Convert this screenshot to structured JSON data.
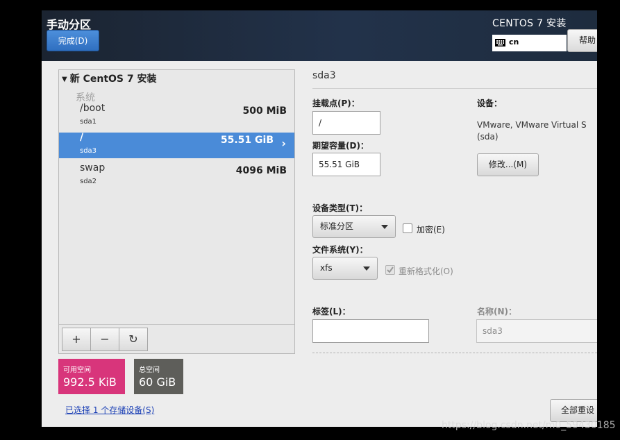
{
  "header": {
    "page_title": "手动分区",
    "done_label": "完成(D)",
    "product_title": "CENTOS 7 安装",
    "keyboard_layout": "cn",
    "help_label": "帮助"
  },
  "partition_panel": {
    "install_title": "新 CentOS 7 安装",
    "group_label": "系统",
    "partitions": [
      {
        "mount": "/boot",
        "device": "sda1",
        "size": "500 MiB",
        "selected": false
      },
      {
        "mount": "/",
        "device": "sda3",
        "size": "55.51 GiB",
        "selected": true
      },
      {
        "mount": "swap",
        "device": "sda2",
        "size": "4096 MiB",
        "selected": false
      }
    ],
    "toolbar": {
      "add_glyph": "+",
      "remove_glyph": "−",
      "refresh_glyph": "↻"
    }
  },
  "space": {
    "available_label": "可用空间",
    "available_value": "992.5 KiB",
    "total_label": "总空间",
    "total_value": "60 GiB",
    "available_color": "#d8357b",
    "total_color": "#5e5e5a"
  },
  "selected_devices_link": "已选择 1 个存储设备(S)",
  "details": {
    "title": "sda3",
    "mount_point_label": "挂载点(P)：",
    "mount_point_value": "/",
    "desired_capacity_label": "期望容量(D)：",
    "desired_capacity_value": "55.51 GiB",
    "device_label": "设备：",
    "device_desc": "VMware, VMware Virtual S (sda)",
    "modify_label": "修改...(M)",
    "device_type_label": "设备类型(T)：",
    "device_type_value": "标准分区",
    "encrypt_label": "加密(E)",
    "filesystem_label": "文件系统(Y)：",
    "filesystem_value": "xfs",
    "reformat_label": "重新格式化(O)",
    "tag_label": "标签(L)：",
    "tag_value": "",
    "name_label": "名称(N)：",
    "name_value": "sda3",
    "reset_all_label": "全部重设"
  },
  "watermark": "https://blog.csdn.net/m0_59430185",
  "colors": {
    "accent": "#4a8bd8",
    "done_button": "#3a7ccc"
  }
}
